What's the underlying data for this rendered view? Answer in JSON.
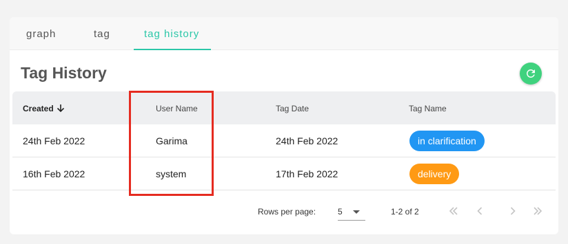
{
  "tabs": [
    {
      "label": "graph"
    },
    {
      "label": "tag"
    },
    {
      "label": "tag history"
    }
  ],
  "active_tab": 2,
  "page_title": "Tag History",
  "table": {
    "columns": [
      "Created",
      "User Name",
      "Tag Date",
      "Tag Name"
    ],
    "sort": {
      "column": "Created",
      "direction": "descending"
    },
    "rows": [
      {
        "created": "24th Feb 2022",
        "user": "Garima",
        "tag_date": "24th Feb 2022",
        "tag_name": "in clarification",
        "tag_color": "#2196f3"
      },
      {
        "created": "16th Feb 2022",
        "user": "system",
        "tag_date": "17th Feb 2022",
        "tag_name": "delivery",
        "tag_color": "#ff9a14"
      }
    ]
  },
  "pagination": {
    "rows_per_page_label": "Rows per page:",
    "rows_per_page": "5",
    "range": "1-2 of 2"
  },
  "icons": {
    "refresh": "refresh-icon",
    "sort": "arrow-down-icon",
    "first_page": "first-page-icon",
    "prev_page": "chevron-left-icon",
    "next_page": "chevron-right-icon",
    "last_page": "last-page-icon"
  },
  "colors": {
    "accent": "#2bc7a8",
    "refresh_button": "#3fd27e",
    "highlight_box": "#e52b20"
  }
}
